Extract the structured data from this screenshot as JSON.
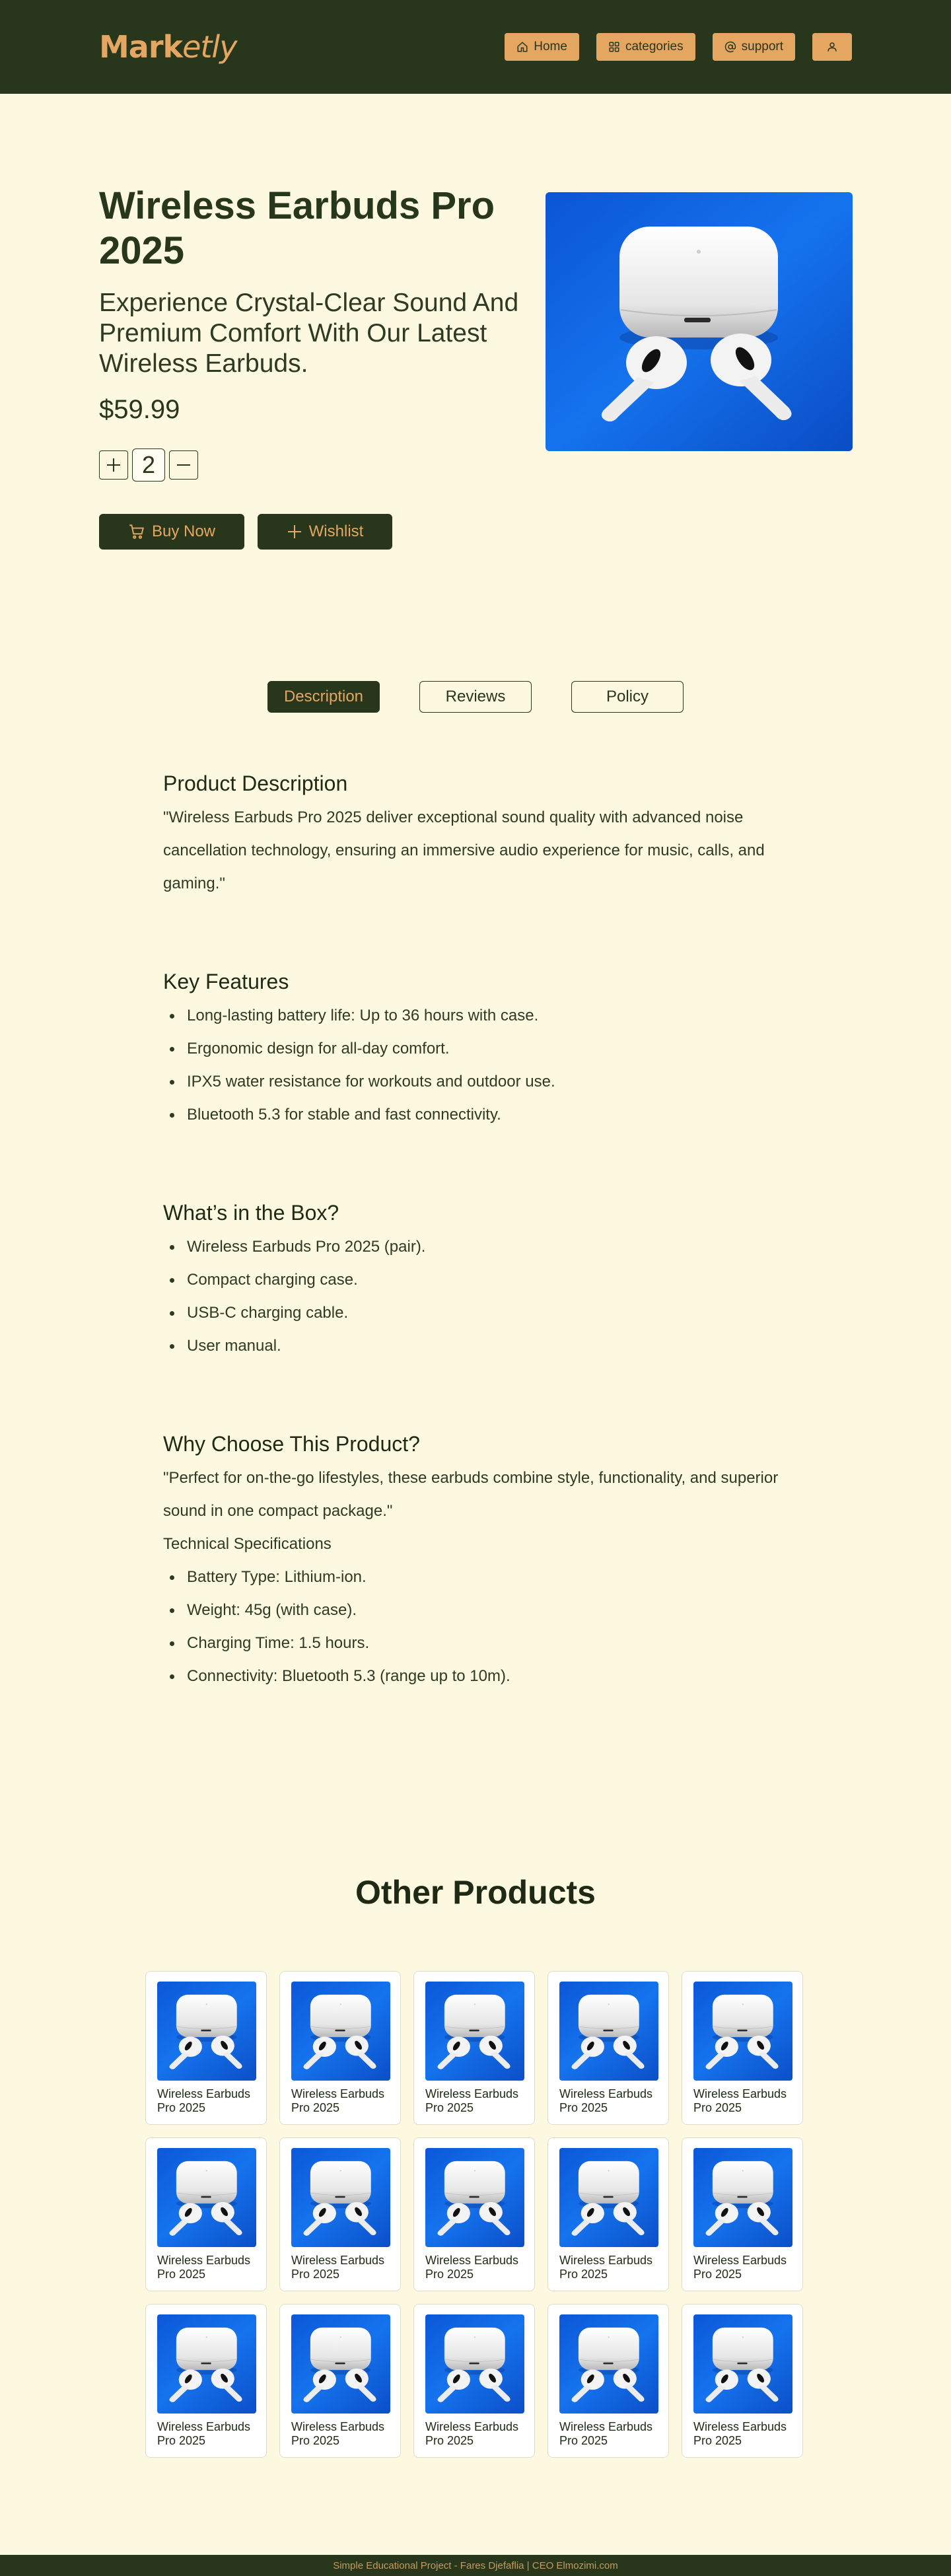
{
  "header": {
    "logo_bold": "Mark",
    "logo_italic": "etly",
    "nav": [
      {
        "label": "Home",
        "icon": "home-icon"
      },
      {
        "label": "categories",
        "icon": "grid-icon"
      },
      {
        "label": "support",
        "icon": "at-icon"
      },
      {
        "label": "",
        "icon": "user-icon"
      }
    ]
  },
  "product": {
    "title": "Wireless Earbuds Pro 2025",
    "subtitle": "Experience Crystal-Clear Sound And Premium Comfort With Our Latest Wireless Earbuds.",
    "price": "$59.99",
    "quantity": "2",
    "buy_label": "Buy Now",
    "wishlist_label": "Wishlist"
  },
  "tabs": [
    "Description",
    "Reviews",
    "Policy"
  ],
  "description": {
    "heading": "Product Description",
    "text": "\"Wireless Earbuds Pro 2025 deliver exceptional sound quality with advanced noise cancellation technology, ensuring an immersive audio experience for music, calls, and gaming.\"",
    "features_heading": "Key Features",
    "features": [
      "Long-lasting battery life: Up to 36 hours with case.",
      "Ergonomic design for all-day comfort.",
      "IPX5 water resistance for workouts and outdoor use.",
      "Bluetooth 5.3 for stable and fast connectivity."
    ],
    "box_heading": "What’s in the Box?",
    "box_items": [
      "Wireless Earbuds Pro 2025 (pair).",
      "Compact charging case.",
      "USB-C charging cable.",
      "User manual."
    ],
    "why_heading": "Why Choose This Product?",
    "why_text": "\"Perfect for on-the-go lifestyles, these earbuds combine style, functionality, and superior sound in one compact package.\"",
    "tech_heading": "Technical Specifications",
    "tech_items": [
      "Battery Type: Lithium-ion.",
      "Weight: 45g (with case).",
      "Charging Time: 1.5 hours.",
      "Connectivity: Bluetooth 5.3 (range up to 10m)."
    ]
  },
  "other": {
    "title": "Other Products",
    "products": [
      "Wireless Earbuds Pro 2025",
      "Wireless Earbuds Pro 2025",
      "Wireless Earbuds Pro 2025",
      "Wireless Earbuds Pro 2025",
      "Wireless Earbuds Pro 2025",
      "Wireless Earbuds Pro 2025",
      "Wireless Earbuds Pro 2025",
      "Wireless Earbuds Pro 2025",
      "Wireless Earbuds Pro 2025",
      "Wireless Earbuds Pro 2025",
      "Wireless Earbuds Pro 2025",
      "Wireless Earbuds Pro 2025",
      "Wireless Earbuds Pro 2025",
      "Wireless Earbuds Pro 2025",
      "Wireless Earbuds Pro 2025"
    ]
  },
  "footer": {
    "text": "Simple Educational Project - Fares Djefaflia | CEO Elmozimi.com"
  },
  "colors": {
    "background": "#fdf9e1",
    "dark_green": "#28361b",
    "accent": "#e5a662",
    "product_blue": "#1466e0"
  }
}
